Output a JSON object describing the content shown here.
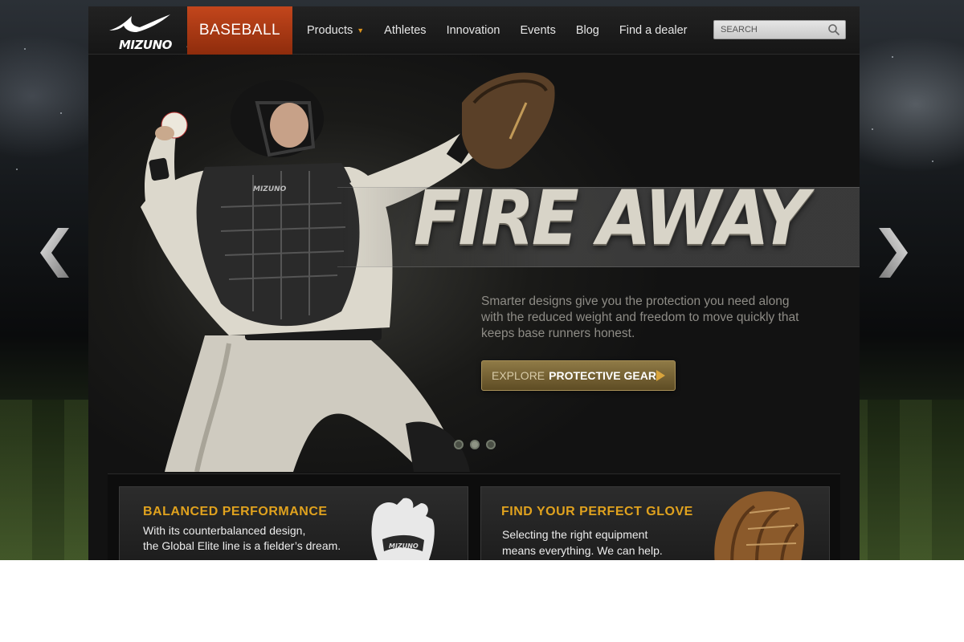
{
  "header": {
    "logo_text": "MIZUNO",
    "sport_tab": "BASEBALL",
    "nav": [
      {
        "label": "Products",
        "has_dropdown": true
      },
      {
        "label": "Athletes"
      },
      {
        "label": "Innovation"
      },
      {
        "label": "Events"
      },
      {
        "label": "Blog"
      },
      {
        "label": "Find a dealer"
      }
    ],
    "search": {
      "placeholder": "SEARCH",
      "icon": "search-icon"
    }
  },
  "hero": {
    "headline": "FIRE AWAY",
    "copy": "Smarter designs give you the protection you need along with the reduced weight and freedom to move quickly that keeps base runners honest.",
    "cta": {
      "prefix": "EXPLORE",
      "label": "PROTECTIVE GEAR",
      "icon": "play-arrow-icon"
    },
    "slides": 3,
    "active_slide": 2
  },
  "carousel": {
    "prev_icon": "chevron-left-icon",
    "next_icon": "chevron-right-icon"
  },
  "promos": [
    {
      "title": "BALANCED PERFORMANCE",
      "lines": [
        "With its counterbalanced design,",
        "the Global Elite line is a fielder’s dream."
      ]
    },
    {
      "title": "FIND YOUR PERFECT GLOVE",
      "lines": [
        "Selecting the right equipment",
        "means everything. We can help."
      ]
    }
  ],
  "colors": {
    "accent_orange": "#c3461c",
    "gold": "#e0a21e",
    "cta": "#8f7a46"
  }
}
